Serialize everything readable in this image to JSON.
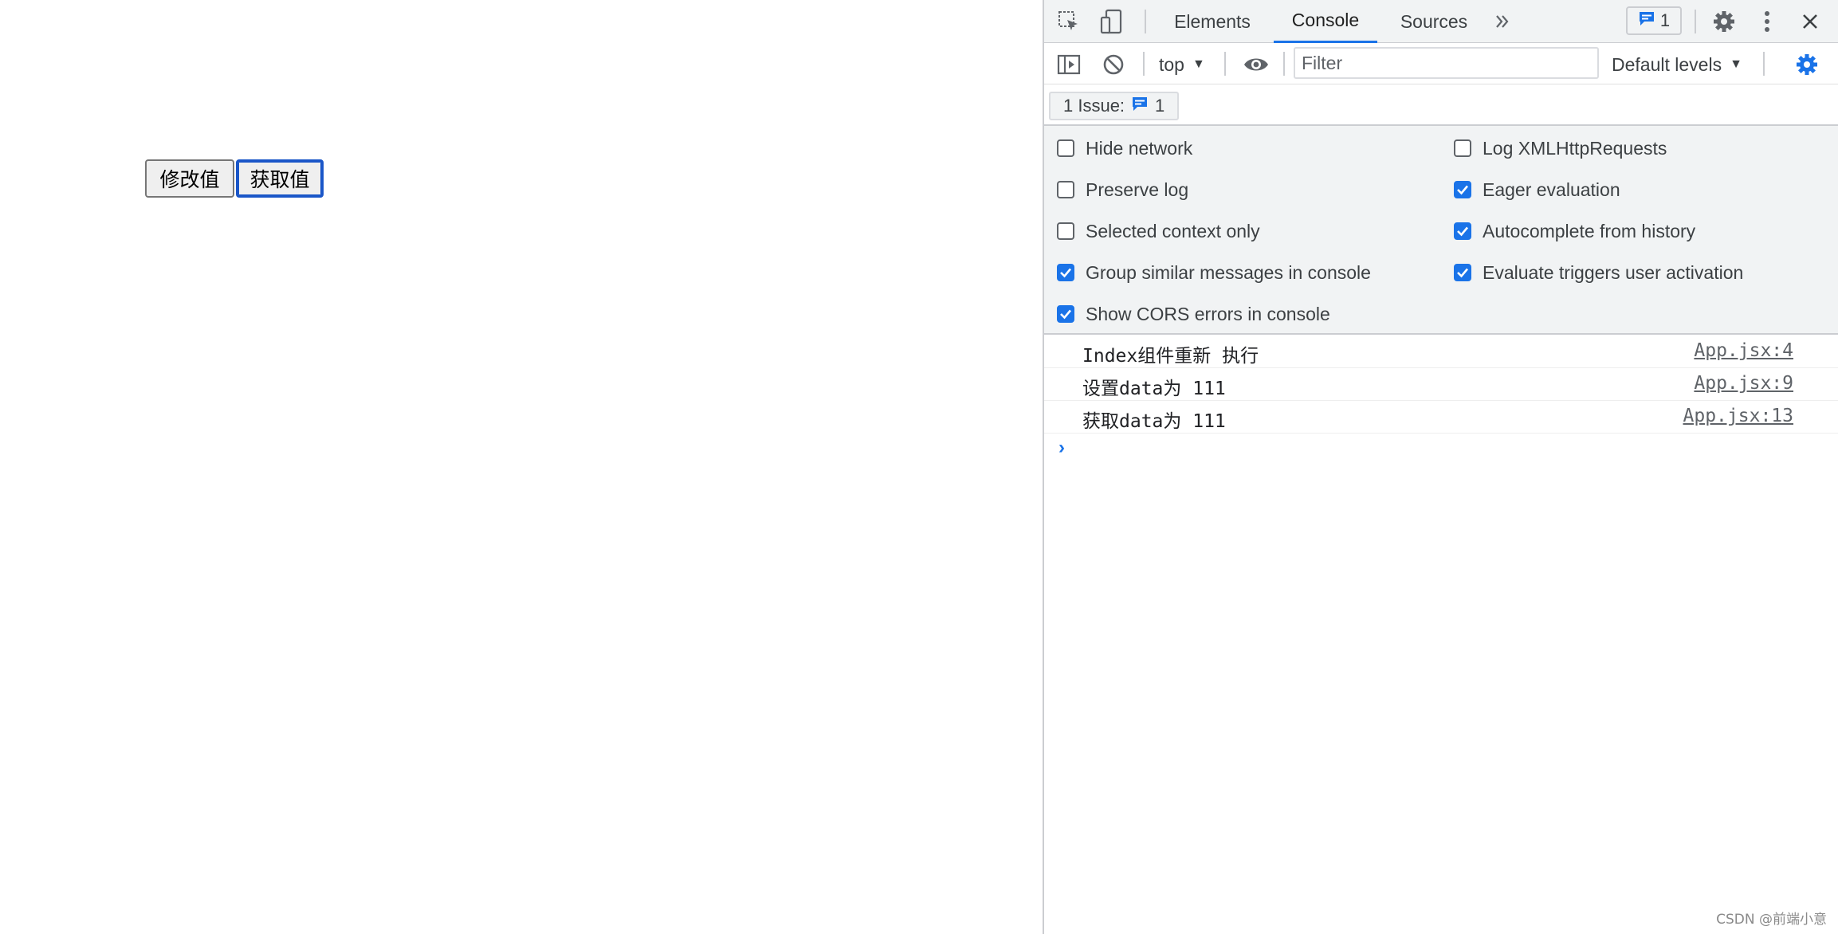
{
  "page": {
    "buttons": {
      "modify_label": "修改值",
      "get_label": "获取值"
    }
  },
  "devtools": {
    "tabs": [
      {
        "label": "Elements",
        "active": false
      },
      {
        "label": "Console",
        "active": true
      },
      {
        "label": "Sources",
        "active": false
      }
    ],
    "more_tabs_icon": "chevron-double-right-icon",
    "issue_badge_count": "1",
    "console_toolbar": {
      "context": "top",
      "filter_placeholder": "Filter",
      "levels": "Default levels"
    },
    "issues_bar": {
      "label": "1 Issue:",
      "count": "1"
    },
    "settings": {
      "left": [
        {
          "label": "Hide network",
          "checked": false
        },
        {
          "label": "Preserve log",
          "checked": false
        },
        {
          "label": "Selected context only",
          "checked": false
        },
        {
          "label": "Group similar messages in console",
          "checked": true
        },
        {
          "label": "Show CORS errors in console",
          "checked": true
        }
      ],
      "right": [
        {
          "label": "Log XMLHttpRequests",
          "checked": false
        },
        {
          "label": "Eager evaluation",
          "checked": true
        },
        {
          "label": "Autocomplete from history",
          "checked": true
        },
        {
          "label": "Evaluate triggers user activation",
          "checked": true
        }
      ]
    },
    "messages": [
      {
        "text": "Index组件重新 执行",
        "source": "App.jsx:4"
      },
      {
        "text": "设置data为 111",
        "source": "App.jsx:9"
      },
      {
        "text": "获取data为 111",
        "source": "App.jsx:13"
      }
    ],
    "prompt_symbol": "›"
  },
  "watermark": "CSDN @前端小意",
  "colors": {
    "accent": "#1a73e8",
    "toolbar_bg": "#f1f3f4",
    "border": "#cbcdd1"
  }
}
